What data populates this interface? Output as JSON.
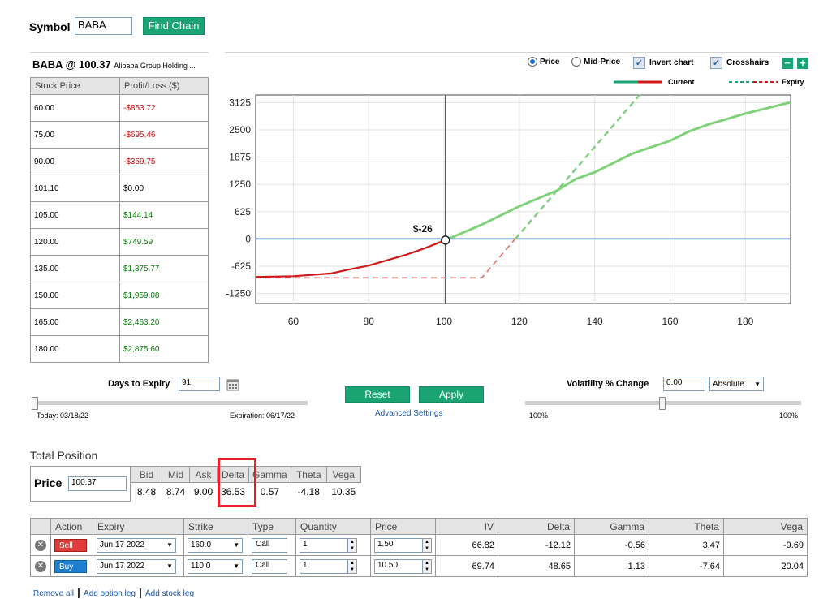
{
  "symbol": {
    "label": "Symbol",
    "value": "BABA",
    "find_label": "Find Chain"
  },
  "stock": {
    "title": "BABA @ 100.37",
    "company": "Alibaba Group Holding ...",
    "headers": [
      "Stock Price",
      "Profit/Loss ($)"
    ],
    "rows": [
      {
        "price": "60.00",
        "pl": "-$853.72",
        "sign": "neg"
      },
      {
        "price": "75.00",
        "pl": "-$695.46",
        "sign": "neg"
      },
      {
        "price": "90.00",
        "pl": "-$359.75",
        "sign": "neg"
      },
      {
        "price": "101.10",
        "pl": "$0.00",
        "sign": "zero"
      },
      {
        "price": "105.00",
        "pl": "$144.14",
        "sign": "pos"
      },
      {
        "price": "120.00",
        "pl": "$749.59",
        "sign": "pos"
      },
      {
        "price": "135.00",
        "pl": "$1,375.77",
        "sign": "pos"
      },
      {
        "price": "150.00",
        "pl": "$1,959.08",
        "sign": "pos"
      },
      {
        "price": "165.00",
        "pl": "$2,463.20",
        "sign": "pos"
      },
      {
        "price": "180.00",
        "pl": "$2,875.60",
        "sign": "pos"
      }
    ]
  },
  "controls": {
    "price_label": "Price",
    "mid_label": "Mid-Price",
    "invert_label": "Invert chart",
    "crosshairs_label": "Crosshairs",
    "minus": "−",
    "plus": "+",
    "legend_current": "Current",
    "legend_expiry": "Expiry"
  },
  "chart_data": {
    "type": "line",
    "x_ticks": [
      60,
      80,
      100,
      120,
      140,
      160,
      180
    ],
    "y_ticks": [
      3125,
      2500,
      1875,
      1250,
      625,
      0,
      -625,
      -1250
    ],
    "xlim": [
      50,
      192
    ],
    "ylim": [
      -1480,
      3300
    ],
    "crosshair_x": 100.37,
    "marker": {
      "x": 100.37,
      "y": -26,
      "label": "$-26"
    },
    "colors": {
      "current_neg": "#d01a1a",
      "current_pos": "#7fd27a",
      "expiry_neg": "#e46b6b",
      "expiry_pos": "#86cc86",
      "zero": "#2a55c0"
    },
    "current": [
      [
        50,
        -870
      ],
      [
        60,
        -853.72
      ],
      [
        70,
        -790
      ],
      [
        75,
        -695.46
      ],
      [
        80,
        -610
      ],
      [
        90,
        -359.75
      ],
      [
        95,
        -210
      ],
      [
        100.37,
        -26
      ],
      [
        101.1,
        0
      ],
      [
        105,
        144.14
      ],
      [
        110,
        330
      ],
      [
        120,
        749.59
      ],
      [
        130,
        1110
      ],
      [
        135,
        1375.77
      ],
      [
        140,
        1530
      ],
      [
        150,
        1959.08
      ],
      [
        160,
        2250
      ],
      [
        165,
        2463.2
      ],
      [
        170,
        2620
      ],
      [
        180,
        2875.6
      ],
      [
        192,
        3130
      ]
    ],
    "expiry": [
      [
        50,
        -890
      ],
      [
        110,
        -890
      ],
      [
        120,
        110
      ],
      [
        130,
        1110
      ],
      [
        140,
        2110
      ],
      [
        152,
        3310
      ]
    ]
  },
  "expiry_ctl": {
    "label": "Days to Expiry",
    "value": "91",
    "today": "Today: 03/18/22",
    "expiration": "Expiration: 06/17/22"
  },
  "actions": {
    "reset": "Reset",
    "apply": "Apply",
    "advanced": "Advanced Settings"
  },
  "vol_ctl": {
    "label": "Volatility % Change",
    "value": "0.00",
    "mode": "Absolute",
    "min": "-100%",
    "max": "100%"
  },
  "total": {
    "label": "Total Position",
    "price_label": "Price",
    "price_value": "100.37",
    "headers": [
      "Bid",
      "Mid",
      "Ask",
      "Delta",
      "Gamma",
      "Theta",
      "Vega"
    ],
    "values": [
      "8.48",
      "8.74",
      "9.00",
      "36.53",
      "0.57",
      "-4.18",
      "10.35"
    ]
  },
  "legs": {
    "headers": [
      "Action",
      "Expiry",
      "Strike",
      "Type",
      "Quantity",
      "Price",
      "IV",
      "Delta",
      "Gamma",
      "Theta",
      "Vega"
    ],
    "rows": [
      {
        "action": "Sell",
        "expiry": "Jun 17 2022",
        "strike": "160.0",
        "type": "Call",
        "qty": "1",
        "price": "1.50",
        "iv": "66.82",
        "delta": "-12.12",
        "gamma": "-0.56",
        "theta": "3.47",
        "vega": "-9.69"
      },
      {
        "action": "Buy",
        "expiry": "Jun 17 2022",
        "strike": "110.0",
        "type": "Call",
        "qty": "1",
        "price": "10.50",
        "iv": "69.74",
        "delta": "48.65",
        "gamma": "1.13",
        "theta": "-7.64",
        "vega": "20.04"
      }
    ]
  },
  "footer_links": {
    "remove_all": "Remove all",
    "add_option": "Add option leg",
    "add_stock": "Add stock leg"
  }
}
